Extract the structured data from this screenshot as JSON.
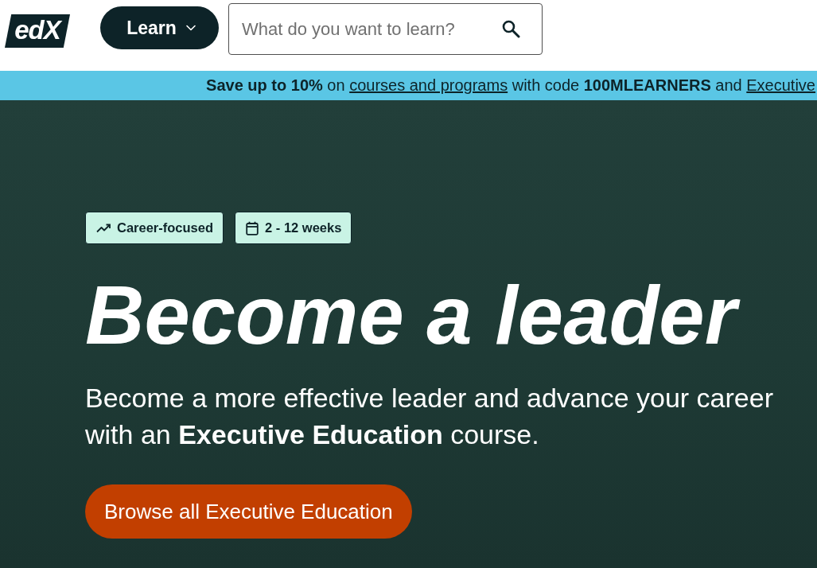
{
  "header": {
    "logo": "edX",
    "menu_button": {
      "label": "Learn"
    },
    "search": {
      "placeholder": "What do you want to learn?"
    }
  },
  "promo_banner": {
    "parts": [
      {
        "kind": "bold",
        "text": "Save up to 10%"
      },
      {
        "kind": "text",
        "text": " on "
      },
      {
        "kind": "link",
        "text": "courses and programs"
      },
      {
        "kind": "text",
        "text": " with code "
      },
      {
        "kind": "bold",
        "text": "100MLEARNERS"
      },
      {
        "kind": "text",
        "text": " and "
      },
      {
        "kind": "link",
        "text": "Executive"
      }
    ]
  },
  "hero": {
    "tags": [
      {
        "kind": "trend",
        "label": "Career-focused"
      },
      {
        "kind": "duration",
        "label": "2 - 12 weeks"
      }
    ],
    "title": "Become a leader",
    "subtitle": "Become a more effective leader and advance your career with an **Executive Education** course.",
    "cta": "Browse all Executive Education"
  }
}
